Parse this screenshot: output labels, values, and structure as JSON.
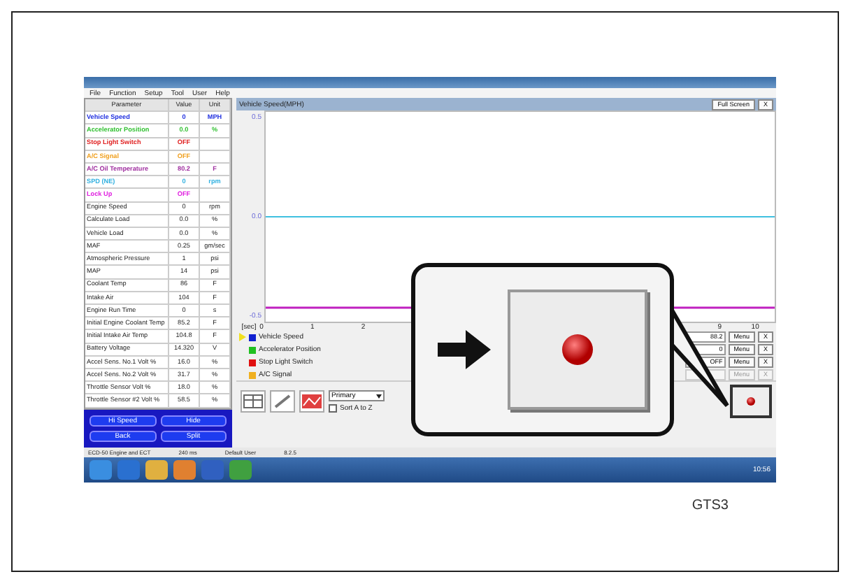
{
  "window": {
    "menu": [
      "File",
      "Function",
      "Setup",
      "Tool",
      "User",
      "Help"
    ]
  },
  "parameters": {
    "columns": [
      "Parameter",
      "Value",
      "Unit"
    ],
    "rows": [
      {
        "name": "Vehicle Speed",
        "value": "0",
        "unit": "MPH",
        "color": "#2030e0"
      },
      {
        "name": "Accelerator Position",
        "value": "0.0",
        "unit": "%",
        "color": "#30c030"
      },
      {
        "name": "Stop Light Switch",
        "value": "OFF",
        "unit": "",
        "color": "#e02020"
      },
      {
        "name": "A/C Signal",
        "value": "OFF",
        "unit": "",
        "color": "#f0a020"
      },
      {
        "name": "A/C Oil Temperature",
        "value": "80.2",
        "unit": "F",
        "color": "#a030a0"
      },
      {
        "name": "SPD (NE)",
        "value": "0",
        "unit": "rpm",
        "color": "#30b0e0"
      },
      {
        "name": "Lock Up",
        "value": "OFF",
        "unit": "",
        "color": "#e020e0"
      },
      {
        "name": "Engine Speed",
        "value": "0",
        "unit": "rpm"
      },
      {
        "name": "Calculate Load",
        "value": "0.0",
        "unit": "%"
      },
      {
        "name": "Vehicle Load",
        "value": "0.0",
        "unit": "%"
      },
      {
        "name": "MAF",
        "value": "0.25",
        "unit": "gm/sec"
      },
      {
        "name": "Atmospheric Pressure",
        "value": "1",
        "unit": "psi"
      },
      {
        "name": "MAP",
        "value": "14",
        "unit": "psi"
      },
      {
        "name": "Coolant Temp",
        "value": "86",
        "unit": "F"
      },
      {
        "name": "Intake Air",
        "value": "104",
        "unit": "F"
      },
      {
        "name": "Engine Run Time",
        "value": "0",
        "unit": "s"
      },
      {
        "name": "Initial Engine Coolant Temp",
        "value": "85.2",
        "unit": "F"
      },
      {
        "name": "Initial Intake Air Temp",
        "value": "104.8",
        "unit": "F"
      },
      {
        "name": "Battery Voltage",
        "value": "14.320",
        "unit": "V"
      },
      {
        "name": "Accel Sens. No.1 Volt %",
        "value": "16.0",
        "unit": "%"
      },
      {
        "name": "Accel Sens. No.2 Volt %",
        "value": "31.7",
        "unit": "%"
      },
      {
        "name": "Throttle Sensor Volt %",
        "value": "18.0",
        "unit": "%"
      },
      {
        "name": "Throttle Sensor #2 Volt %",
        "value": "58.5",
        "unit": "%"
      }
    ]
  },
  "nav_buttons": [
    "Hi Speed",
    "Hide",
    "Back",
    "Split"
  ],
  "graph": {
    "title": "Vehicle Speed(MPH)",
    "full_screen": "Full Screen",
    "close": "X",
    "y_labels": [
      "0.5",
      "0.0",
      "-0.5"
    ],
    "x_unit": "[sec]",
    "x_labels": [
      "0",
      "1",
      "2",
      "9",
      "10"
    ]
  },
  "legend": [
    {
      "label": "Vehicle Speed",
      "color": "#1020d0",
      "selected": true
    },
    {
      "label": "Accelerator Position",
      "color": "#20c020",
      "selected": false
    },
    {
      "label": "Stop Light Switch",
      "color": "#e01010",
      "selected": false
    },
    {
      "label": "A/C Signal",
      "color": "#f0b020",
      "selected": false
    }
  ],
  "readouts": [
    {
      "value": "88.2",
      "menu": "Menu",
      "close": "X",
      "disabled": false
    },
    {
      "value": "0",
      "menu": "Menu",
      "close": "X",
      "disabled": false
    },
    {
      "value": "OFF",
      "menu": "Menu",
      "close": "X",
      "disabled": false
    },
    {
      "menu": "Menu",
      "close": "X",
      "disabled": true
    }
  ],
  "toolbar": {
    "select": "Primary",
    "sort_label": "Sort A to Z",
    "sort_checked": false
  },
  "status_bar": [
    "ECD-50 Engine and ECT",
    "240 ms",
    "Default User",
    "8.2.5"
  ],
  "clock": "10:56",
  "figure_label": "GTS3"
}
